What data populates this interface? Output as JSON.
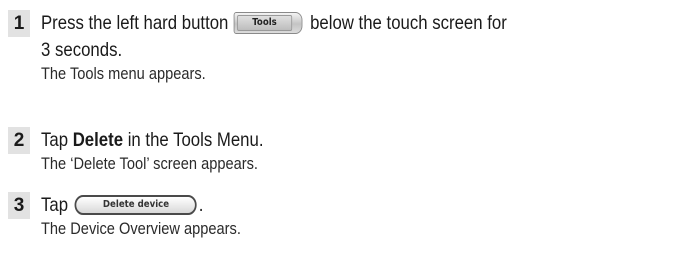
{
  "steps": [
    {
      "number": "1",
      "line1_before": "Press the left hard button",
      "button_label": "Tools",
      "line1_after": "below the touch screen for",
      "line2": "3 seconds.",
      "result": "The Tools menu appears."
    },
    {
      "number": "2",
      "before": "Tap ",
      "bold": "Delete",
      "after": " in the Tools Menu.",
      "result": "The ‘Delete Tool’ screen appears."
    },
    {
      "number": "3",
      "before": "Tap",
      "button_label": "Delete device",
      "after": ".",
      "result": "The Device Overview appears."
    }
  ]
}
